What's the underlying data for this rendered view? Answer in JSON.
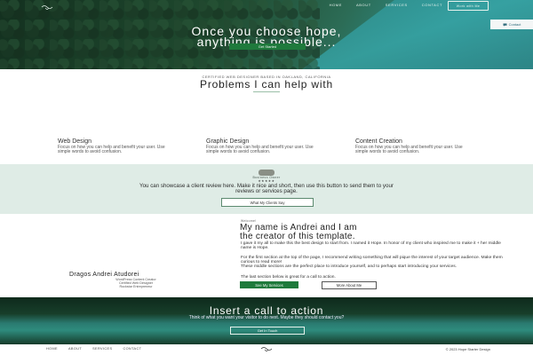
{
  "hero": {
    "nav": [
      "Home",
      "About",
      "Services",
      "Contact"
    ],
    "contact_button": "Work with Me",
    "headline_line1": "Once you choose hope,",
    "headline_line2": "anything is possible...",
    "cta_button": "Get Started",
    "side_button": "Contact",
    "side_icon": "chat-bubble-icon"
  },
  "problems": {
    "eyebrow": "CERTIFIED WEB DESIGNER BASED IN OAKLAND, CALIFORNIA",
    "title": "Problems I can help with",
    "services": [
      {
        "title": "Web Design",
        "text": "Focus on how you can help and benefit your user. Use simple words to avoid confusion."
      },
      {
        "title": "Graphic Design",
        "text": "Focus on how you can help and benefit your user. Use simple words to avoid confusion."
      },
      {
        "title": "Content Creation",
        "text": "Focus on how you can help and benefit your user. Use simple words to avoid confusion."
      }
    ]
  },
  "testimonial": {
    "reviewer": "Business Owner",
    "stars": "★★★★★",
    "quote": "You can showcase a client review here. Make it nice and short, then use this button to send them to your reviews or services page.",
    "button": "What My Clients Say"
  },
  "about": {
    "name": "Dragos Andrei Atudorei",
    "role_lines": [
      "WordPress Content Creator",
      "Certified Web Designer",
      "Rockstar Entrepreneur"
    ],
    "eyebrow": "Welcome!",
    "heading_line1": "My name is Andrei and I am",
    "heading_line2": "the creator of this template.",
    "p1": "I gave it my all to make this the best design to start from. I named it Hope. In honor of my client who inspired me to make it + her middle name is Hope.",
    "p2": "For the first section at the top of the page, I recommend writing something that will pique the interest of your target audience. Make them curious to read more!",
    "p3": "These middle sections are the perfect place to introduce yourself, and to perhaps start introducing your services.",
    "p4": "The last section below is great for a call to action.",
    "button_primary": "See My Services",
    "button_secondary": "More About Me"
  },
  "cta": {
    "title": "Insert a call to action",
    "subtitle": "Think of what you want your visitor to do next. Maybe they should contact you?",
    "button": "Get In Touch"
  },
  "footer": {
    "nav": [
      "Home",
      "About",
      "Services",
      "Contact"
    ],
    "copyright": "© 2023 Hope Starter Design"
  },
  "colors": {
    "accent_green": "#1f7a3c",
    "mint_band": "#dfece6",
    "teal": "#2e8b7d"
  }
}
